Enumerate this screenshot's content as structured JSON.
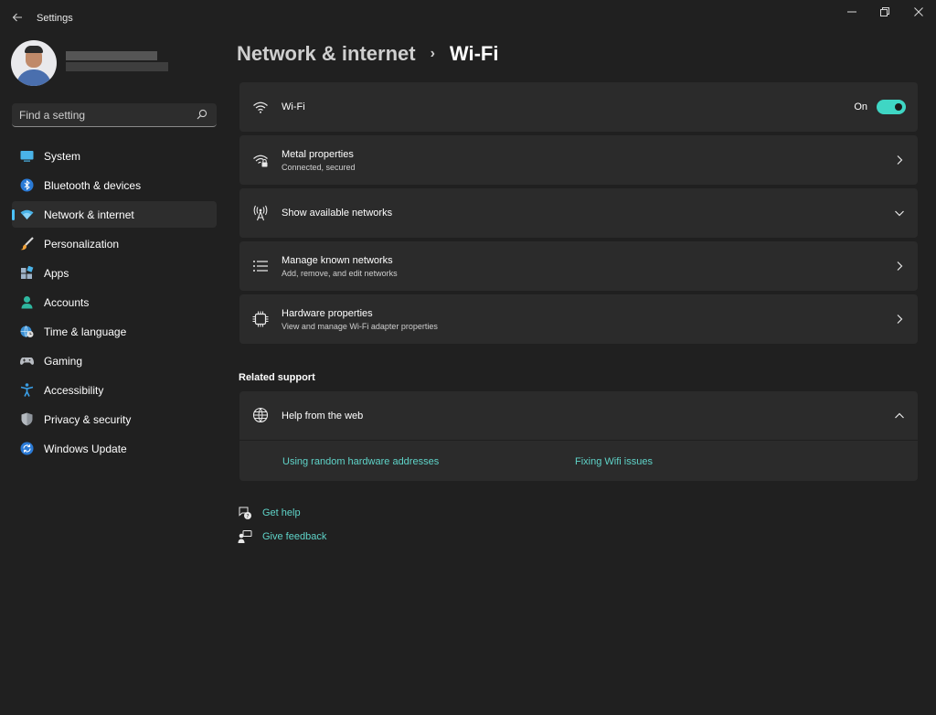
{
  "window": {
    "title": "Settings",
    "controls": [
      "minimize",
      "restore",
      "close"
    ]
  },
  "search": {
    "placeholder": "Find a setting"
  },
  "sidebar": {
    "items": [
      {
        "label": "System",
        "icon": "system-icon",
        "active": false
      },
      {
        "label": "Bluetooth & devices",
        "icon": "bluetooth-icon",
        "active": false
      },
      {
        "label": "Network & internet",
        "icon": "network-icon",
        "active": true
      },
      {
        "label": "Personalization",
        "icon": "brush-icon",
        "active": false
      },
      {
        "label": "Apps",
        "icon": "apps-icon",
        "active": false
      },
      {
        "label": "Accounts",
        "icon": "accounts-icon",
        "active": false
      },
      {
        "label": "Time & language",
        "icon": "globe-clock-icon",
        "active": false
      },
      {
        "label": "Gaming",
        "icon": "gamepad-icon",
        "active": false
      },
      {
        "label": "Accessibility",
        "icon": "accessibility-icon",
        "active": false
      },
      {
        "label": "Privacy & security",
        "icon": "shield-icon",
        "active": false
      },
      {
        "label": "Windows Update",
        "icon": "update-icon",
        "active": false
      }
    ]
  },
  "breadcrumb": {
    "parent": "Network & internet",
    "separator": "›",
    "current": "Wi-Fi"
  },
  "wifi": {
    "toggle": {
      "title": "Wi-Fi",
      "state_label": "On",
      "on": true
    },
    "rows": [
      {
        "title": "Metal properties",
        "subtitle": "Connected, secured",
        "icon": "wifi-lock-icon",
        "chevron": "right"
      },
      {
        "title": "Show available networks",
        "subtitle": "",
        "icon": "antenna-icon",
        "chevron": "down"
      },
      {
        "title": "Manage known networks",
        "subtitle": "Add, remove, and edit networks",
        "icon": "list-icon",
        "chevron": "right"
      },
      {
        "title": "Hardware properties",
        "subtitle": "View and manage Wi-Fi adapter properties",
        "icon": "chip-icon",
        "chevron": "right"
      }
    ]
  },
  "related_support": {
    "heading": "Related support",
    "help_card": {
      "title": "Help from the web",
      "links": [
        "Using random hardware addresses",
        "Fixing Wifi issues"
      ]
    }
  },
  "footer_links": {
    "get_help": "Get help",
    "give_feedback": "Give feedback"
  },
  "colors": {
    "background": "#202020",
    "card": "#2b2b2b",
    "accent": "#3fd6c4",
    "link": "#5fd4c9",
    "nav_indicator": "#4cc2ff"
  }
}
